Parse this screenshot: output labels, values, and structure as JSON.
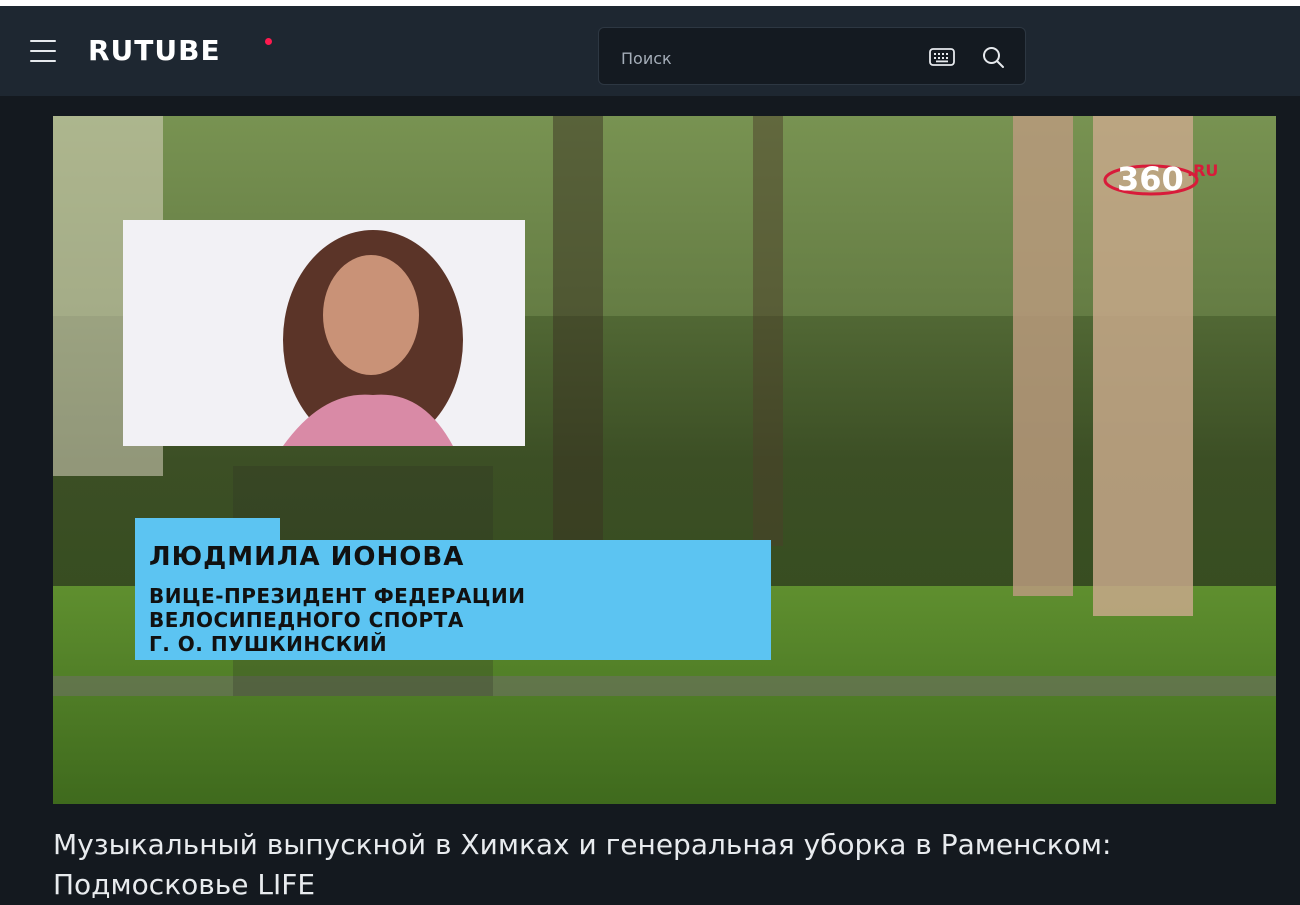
{
  "header": {
    "logo_text": "RUTUBE",
    "search_placeholder": "Поиск"
  },
  "player": {
    "channel_logo": "360",
    "channel_logo_suffix": ".RU",
    "caption": {
      "name": "ЛЮДМИЛА ИОНОВА",
      "line1": "ВИЦЕ-ПРЕЗИДЕНТ ФЕДЕРАЦИИ",
      "line2": "ВЕЛОСИПЕДНОГО СПОРТА",
      "line3": "Г. О. ПУШКИНСКИЙ"
    }
  },
  "video": {
    "title": "Музыкальный выпускной в Химках и генеральная уборка в Раменском: Подмосковье LIFE"
  },
  "colors": {
    "header_bg": "#1e2731",
    "page_bg": "#14191f",
    "logo_accent": "#ff1a4f",
    "caption_bg": "#5cc4f2"
  },
  "icons": {
    "menu": "hamburger-menu-icon",
    "keyboard": "keyboard-icon",
    "search": "search-icon"
  }
}
